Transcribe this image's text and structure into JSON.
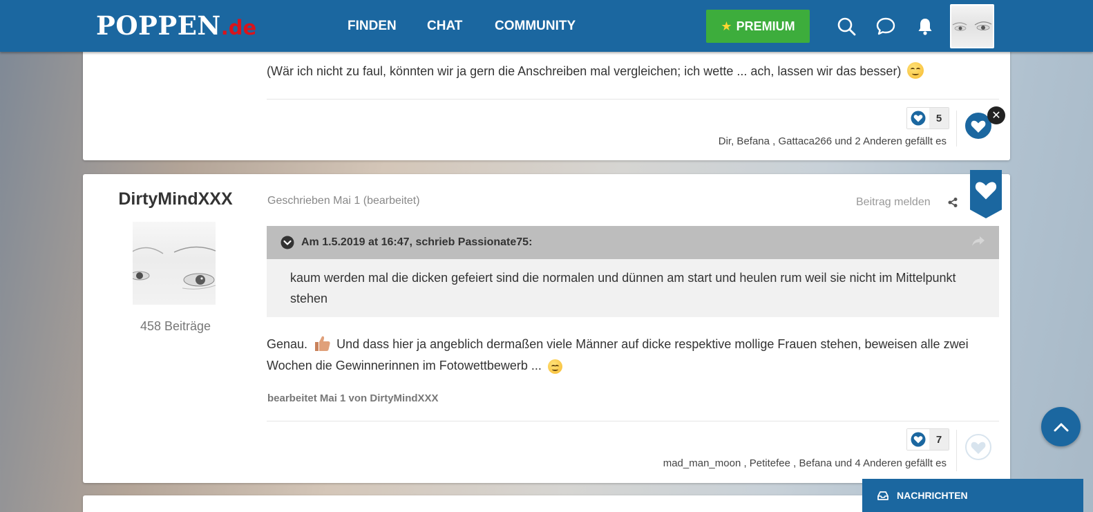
{
  "header": {
    "logo_main": "POPPEN",
    "logo_suffix": ".de",
    "nav": [
      "FINDEN",
      "CHAT",
      "COMMUNITY"
    ],
    "premium_label": "PREMIUM"
  },
  "post_top": {
    "text": "(Wär ich nicht zu faul, könnten wir ja gern die Anschreiben mal vergleichen; ich wette ... ach, lassen wir das besser)",
    "like_count": "5",
    "likers": "Dir, Befana , Gattaca266 und 2 Anderen gefällt es"
  },
  "post_main": {
    "username": "DirtyMindXXX",
    "post_count": "458 Beiträge",
    "meta": "Geschrieben Mai 1 (bearbeitet)",
    "report": "Beitrag melden",
    "quote_header": "Am 1.5.2019 at 16:47, schrieb Passionate75:",
    "quote_body": "kaum werden mal die dicken gefeiert sind die normalen und dünnen am start und heulen rum weil sie nicht im Mittelpunkt stehen",
    "body_part1": "Genau.",
    "body_part2": "Und dass hier ja angeblich dermaßen viele Männer auf dicke respektive mollige Frauen stehen, beweisen alle zwei Wochen die Gewinnerinnen im Fotowettbewerb ...",
    "edited": "bearbeitet Mai 1 von DirtyMindXXX",
    "like_count": "7",
    "likers": "mad_man_moon , Petitefee , Befana und 4 Anderen gefällt es"
  },
  "messages_bar": {
    "label": "NACHRICHTEN"
  },
  "colors": {
    "brand": "#1b67a0",
    "premium": "#3dad3c",
    "accent_red": "#d9141c"
  }
}
